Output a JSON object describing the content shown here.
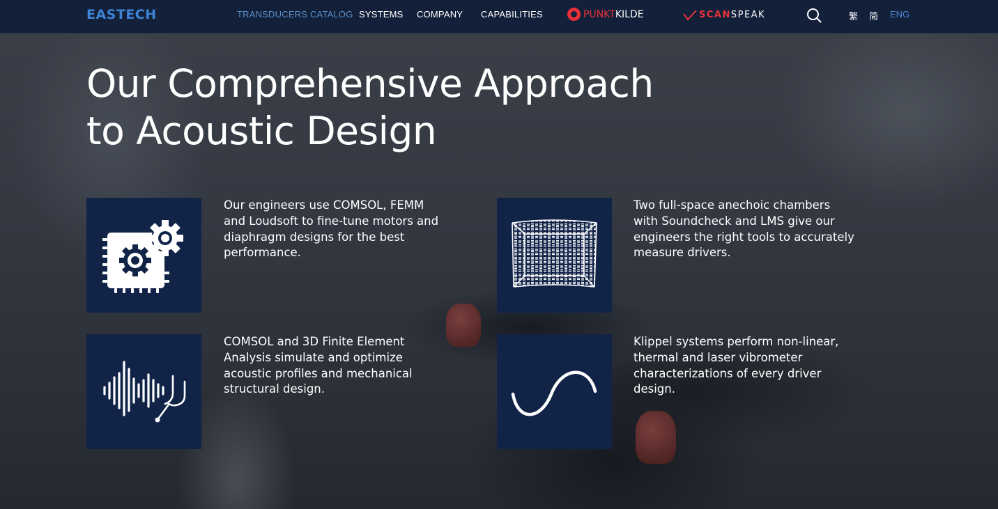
{
  "nav": {
    "logo": "EASTECH",
    "links": [
      "TRANSDUCERS CATALOG",
      "SYSTEMS",
      "COMPANY",
      "CAPABILITIES"
    ],
    "brands": {
      "punkt": {
        "part1": "PUNKT",
        "part2": "KILDE"
      },
      "scanspeak": {
        "part1": "SCAN",
        "part2": "SPEAK"
      }
    },
    "languages": [
      "繁",
      "简",
      "ENG"
    ],
    "active_language": "ENG",
    "active_link": "TRANSDUCERS CATALOG"
  },
  "hero": {
    "title": "Our Comprehensive Approach to Acoustic Design"
  },
  "features": [
    {
      "icon": "gears-chip-icon",
      "text": "Our engineers use COMSOL, FEMM and Loudsoft to fine-tune motors and diaphragm designs for the best performance."
    },
    {
      "icon": "anechoic-chamber-icon",
      "text": "Two full-space anechoic chambers with Soundcheck and LMS give our engineers the right tools to accurately measure drivers."
    },
    {
      "icon": "waveform-tuning-fork-icon",
      "text": "COMSOL and 3D Finite Element Analysis simulate and optimize acoustic profiles and mechanical structural design."
    },
    {
      "icon": "sine-wave-icon",
      "text": "Klippel systems perform non-linear, thermal and laser vibrometer characterizations of every driver design."
    }
  ],
  "colors": {
    "nav_bg": "#12203a",
    "logo": "#3f83d6",
    "active_link": "#5c8fc9",
    "brand_red": "#e8323a",
    "icon_tile": "#112448"
  }
}
